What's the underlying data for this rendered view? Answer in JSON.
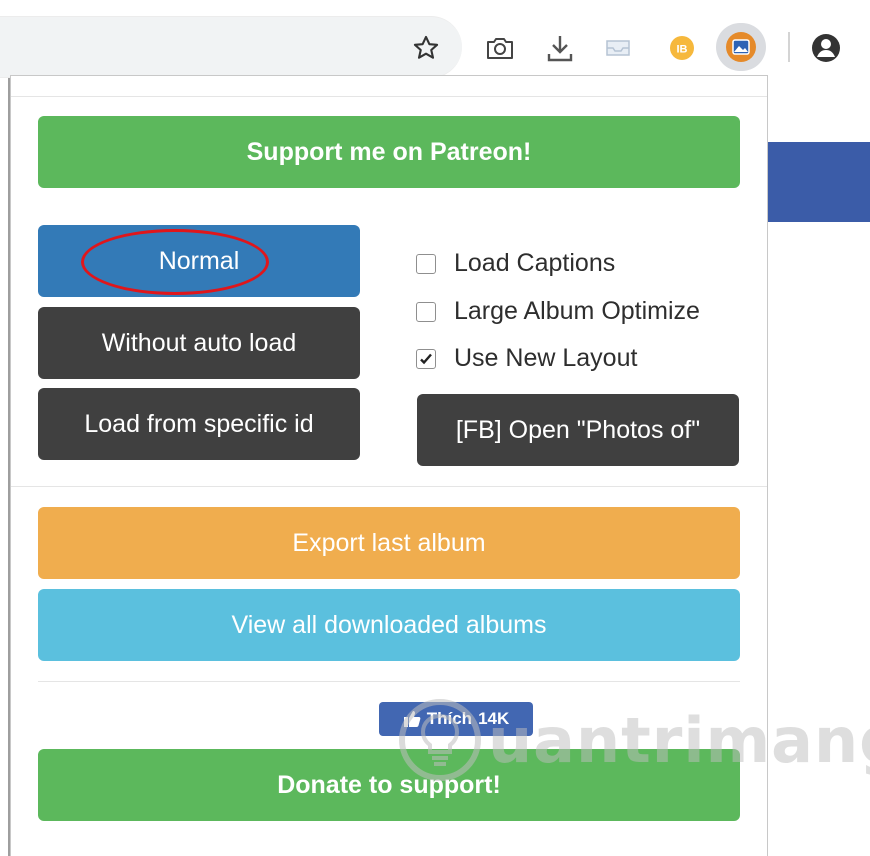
{
  "toolbar": {
    "icons": [
      "star-icon",
      "camera-icon",
      "download-icon",
      "inbox-icon",
      "ib-extension-icon",
      "photo-extension-icon",
      "account-icon"
    ],
    "ib_badge": "IB"
  },
  "popup": {
    "patreon_label": "Support me on Patreon!",
    "modes": {
      "normal": "Normal",
      "without_auto_load": "Without auto load",
      "load_specific_id": "Load from specific id"
    },
    "options": [
      {
        "label": "Load Captions",
        "checked": false
      },
      {
        "label": "Large Album Optimize",
        "checked": false
      },
      {
        "label": "Use New Layout",
        "checked": true
      }
    ],
    "fb_photos_label": "[FB] Open \"Photos of\"",
    "export_label": "Export last album",
    "view_all_label": "View all downloaded albums",
    "like": {
      "label": "Thích",
      "count": "14K"
    },
    "donate_label": "Donate to support!"
  },
  "watermark": "uantrimang",
  "colors": {
    "green": "#5cb85c",
    "blue": "#337ab7",
    "dark": "#404040",
    "orange": "#f0ad4e",
    "cyan": "#5bc0de",
    "facebook": "#4267b2",
    "annotation_red": "#e0161b"
  }
}
